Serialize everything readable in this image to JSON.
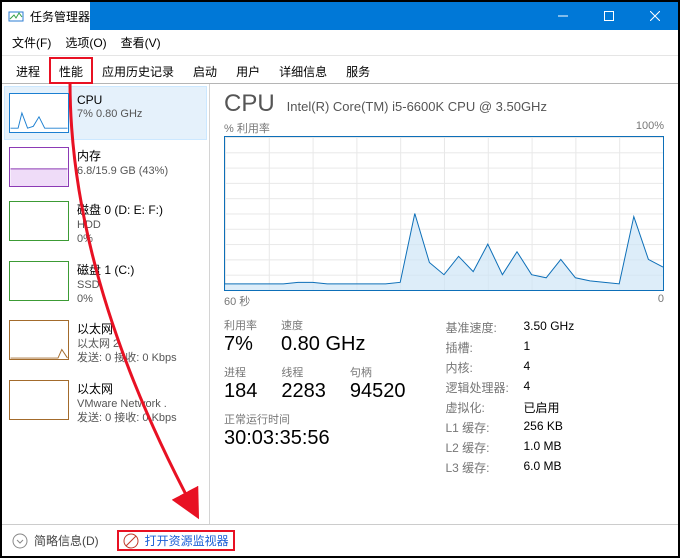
{
  "title": "任务管理器",
  "menu": {
    "file": "文件(F)",
    "options": "选项(O)",
    "view": "查看(V)"
  },
  "tabs": [
    {
      "id": "processes",
      "label": "进程"
    },
    {
      "id": "performance",
      "label": "性能"
    },
    {
      "id": "app-history",
      "label": "应用历史记录"
    },
    {
      "id": "startup",
      "label": "启动"
    },
    {
      "id": "users",
      "label": "用户"
    },
    {
      "id": "details",
      "label": "详细信息"
    },
    {
      "id": "services",
      "label": "服务"
    }
  ],
  "sidebar": [
    {
      "name": "CPU",
      "sub1": "7% 0.80 GHz",
      "sub2": "",
      "color": "#1b7fd1"
    },
    {
      "name": "内存",
      "sub1": "6.8/15.9 GB (43%)",
      "sub2": "",
      "color": "#8c3ab5"
    },
    {
      "name": "磁盘 0 (D: E: F:)",
      "sub1": "HDD",
      "sub2": "0%",
      "color": "#3c9b35"
    },
    {
      "name": "磁盘 1 (C:)",
      "sub1": "SSD",
      "sub2": "0%",
      "color": "#3c9b35"
    },
    {
      "name": "以太网",
      "sub1": "以太网 2",
      "sub2": "发送: 0 接收: 0 Kbps",
      "color": "#a36b2c"
    },
    {
      "name": "以太网",
      "sub1": "VMware Network .",
      "sub2": "发送: 0 接收: 0 Kbps",
      "color": "#a36b2c"
    }
  ],
  "cpu": {
    "title": "CPU",
    "model": "Intel(R) Core(TM) i5-6600K CPU @ 3.50GHz",
    "chart_top_left": "% 利用率",
    "chart_top_right": "100%",
    "chart_bottom_left": "60 秒",
    "chart_bottom_right": "0",
    "util_label": "利用率",
    "util": "7%",
    "speed_label": "速度",
    "speed": "0.80 GHz",
    "proc_label": "进程",
    "proc": "184",
    "thr_label": "线程",
    "thr": "2283",
    "hnd_label": "句柄",
    "hnd": "94520",
    "uptime_label": "正常运行时间",
    "uptime": "30:03:35:56",
    "right": [
      {
        "k": "基准速度:",
        "v": "3.50 GHz"
      },
      {
        "k": "插槽:",
        "v": "1"
      },
      {
        "k": "内核:",
        "v": "4"
      },
      {
        "k": "逻辑处理器:",
        "v": "4"
      },
      {
        "k": "虚拟化:",
        "v": "已启用"
      },
      {
        "k": "L1 缓存:",
        "v": "256 KB"
      },
      {
        "k": "L2 缓存:",
        "v": "1.0 MB"
      },
      {
        "k": "L3 缓存:",
        "v": "6.0 MB"
      }
    ]
  },
  "statusbar": {
    "brief": "简略信息(D)",
    "resmon": "打开资源监视器"
  },
  "chart_data": {
    "type": "line",
    "title": "% 利用率",
    "xlabel": "秒",
    "ylabel": "%",
    "ylim": [
      0,
      100
    ],
    "x_seconds_ago": [
      60,
      58,
      56,
      54,
      52,
      50,
      48,
      46,
      44,
      42,
      40,
      38,
      36,
      34,
      32,
      30,
      28,
      26,
      24,
      22,
      20,
      18,
      16,
      14,
      12,
      10,
      8,
      6,
      4,
      2,
      0
    ],
    "values": [
      4,
      4,
      4,
      4,
      4,
      5,
      5,
      4,
      4,
      4,
      4,
      4,
      5,
      50,
      18,
      10,
      22,
      12,
      30,
      10,
      25,
      10,
      8,
      20,
      8,
      6,
      5,
      4,
      48,
      20,
      15
    ]
  }
}
